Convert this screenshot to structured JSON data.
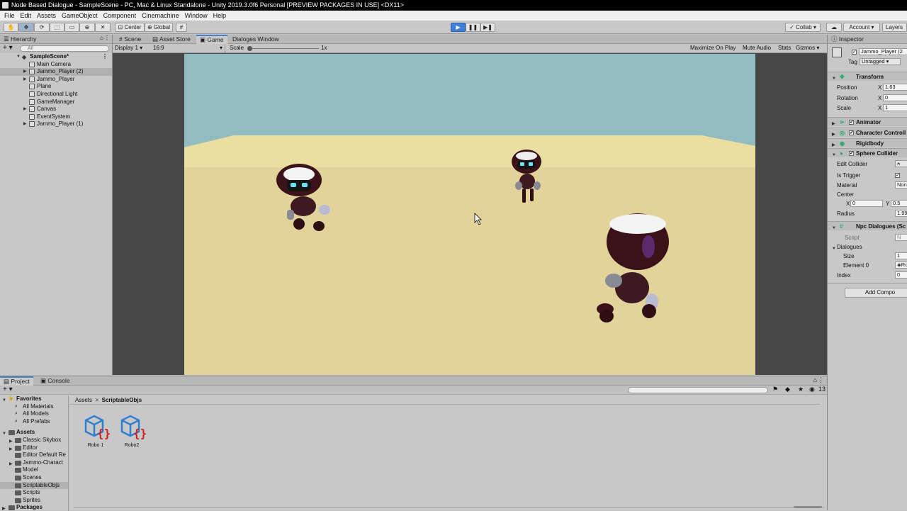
{
  "window": {
    "title": "Node Based Dialogue - SampleScene - PC, Mac & Linux Standalone - Unity 2019.3.0f6 Personal [PREVIEW PACKAGES IN USE] <DX11>"
  },
  "menu": [
    "File",
    "Edit",
    "Assets",
    "GameObject",
    "Component",
    "Cinemachine",
    "Window",
    "Help"
  ],
  "toolbar": {
    "pivot": "Center",
    "space": "Global",
    "collab": "Collab",
    "account": "Account",
    "layers": "Layers"
  },
  "hierarchy": {
    "tab": "Hierarchy",
    "search_placeholder": "All",
    "scene": "SampleScene*",
    "items": [
      {
        "label": "Main Camera",
        "expandable": false
      },
      {
        "label": "Jammo_Player (2)",
        "expandable": true,
        "selected": true
      },
      {
        "label": "Jammo_Player",
        "expandable": true
      },
      {
        "label": "Plane",
        "expandable": false
      },
      {
        "label": "Directional Light",
        "expandable": false
      },
      {
        "label": "GameManager",
        "expandable": false
      },
      {
        "label": "Canvas",
        "expandable": true
      },
      {
        "label": "EventSystem",
        "expandable": false
      },
      {
        "label": "Jammo_Player (1)",
        "expandable": true
      }
    ]
  },
  "center_tabs": [
    "Scene",
    "Asset Store",
    "Game",
    "Dialoges Window"
  ],
  "game_bar": {
    "display": "Display 1",
    "aspect": "16:9",
    "scale_label": "Scale",
    "scale_value": "1x",
    "maximize": "Maximize On Play",
    "mute": "Mute Audio",
    "stats": "Stats",
    "gizmos": "Gizmos"
  },
  "inspector": {
    "tab": "Inspector",
    "object_name": "Jammo_Player (2",
    "tag_label": "Tag",
    "tag_value": "Untagged",
    "transform": "Transform",
    "position_label": "Position",
    "position_x": "1.63",
    "rotation_label": "Rotation",
    "rotation_x": "0",
    "scale_label": "Scale",
    "scale_x": "1",
    "animator": "Animator",
    "character_controller": "Character Controll",
    "rigidbody": "Rigidbody",
    "sphere_collider": "Sphere Collider",
    "edit_collider": "Edit Collider",
    "is_trigger": "Is Trigger",
    "material": "Material",
    "material_value": "None",
    "center": "Center",
    "center_x": "0",
    "center_y": "0.5",
    "radius": "Radius",
    "radius_value": "1.99",
    "npc": "Npc Dialogues (Sc",
    "script": "Script",
    "script_value": "N",
    "dialogues": "Dialogues",
    "size": "Size",
    "size_value": "1",
    "element0": "Element 0",
    "element0_value": "Ro",
    "index": "Index",
    "index_value": "0",
    "add_component": "Add Compo"
  },
  "project": {
    "tabs": [
      "Project",
      "Console"
    ],
    "favorites": "Favorites",
    "fav_items": [
      "All Materials",
      "All Models",
      "All Prefabs"
    ],
    "assets": "Assets",
    "folders": [
      "Classic Skybox",
      "Editor",
      "Editor Default Re",
      "Jammo-Charact",
      "Model",
      "Scenes",
      "ScriptableObjs",
      "Scripts",
      "Sprites"
    ],
    "packages": "Packages",
    "breadcrumb_root": "Assets",
    "breadcrumb_current": "ScriptableObjs",
    "item_count": "13",
    "files": [
      "Robo 1",
      "Robo2"
    ]
  }
}
